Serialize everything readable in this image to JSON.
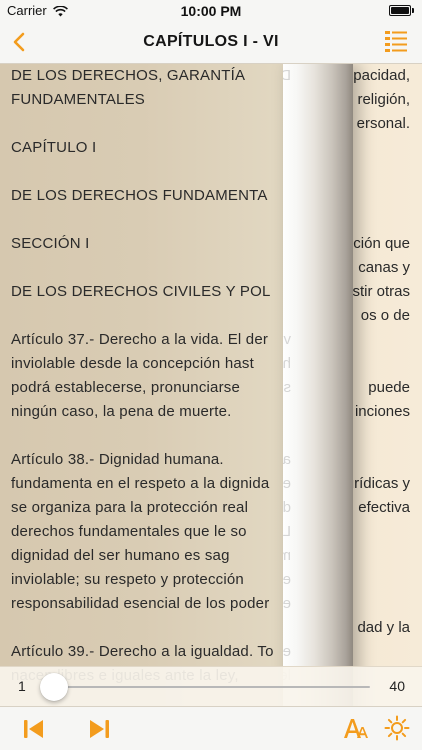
{
  "status": {
    "carrier": "Carrier",
    "time": "10:00 PM",
    "battery_level": 1.0
  },
  "nav": {
    "title": "CAPÍTULOS I - VI",
    "back_icon": "chevron-left-icon",
    "toc_icon": "list-icon"
  },
  "colors": {
    "accent": "#f39c1d",
    "page_cream": "#f2e5cf",
    "slider_fill": "#1f7ae0"
  },
  "page_front_lines": [
    "DE LOS DERECHOS, GARANTÍA",
    "FUNDAMENTALES",
    "",
    "CAPÍTULO I",
    "",
    "DE LOS DERECHOS FUNDAMENTA",
    "",
    "SECCIÓN I",
    "",
    "DE LOS DERECHOS CIVILES Y POL",
    "",
    "Artículo 37.- Derecho a la vida. El der",
    "inviolable desde la concepción hast",
    "podrá establecerse, pronunciarse",
    "ningún caso, la pena de muerte.",
    "",
    "Artículo 38.- Dignidad humana.",
    "fundamenta en el respeto a la dignida",
    "se organiza para la protección real",
    "derechos fundamentales que le so",
    "dignidad del ser humano es sag",
    "inviolable; su respeto y protección",
    "responsabilidad esencial de los poder",
    "",
    "Artículo 39.- Derecho a la igualdad. To",
    "nacen libres e iguales ante la ley,"
  ],
  "page_back_lines": [
    "pacidad,",
    "religión,",
    "ersonal.",
    "",
    "",
    "",
    "",
    "ción que",
    "canas y",
    "stir otras",
    "os o de",
    "",
    "",
    "puede",
    "inciones",
    "",
    "",
    "urídicas y",
    "efectiva",
    "",
    "",
    "",
    "",
    "dad y la",
    "",
    ""
  ],
  "curl_lines": [
    "DEBERES",
    "",
    "",
    "",
    "",
    "",
    "",
    "",
    "",
    "",
    "",
    "vida es",
    "he. No",
    "se, en",
    "",
    "",
    "ado se",
    "ersonas",
    "de los",
    "Las",
    "mata e",
    "en una",
    "es.",
    "",
    "ersonas",
    "ley"
  ],
  "slider": {
    "min_label": "1",
    "max_label": "40",
    "value": 1,
    "min": 1,
    "max": 40
  },
  "toolbar": {
    "first_page_icon": "skip-back-icon",
    "next_page_icon": "skip-forward-icon",
    "font_size_icon": "text-size-icon",
    "brightness_icon": "brightness-icon"
  }
}
